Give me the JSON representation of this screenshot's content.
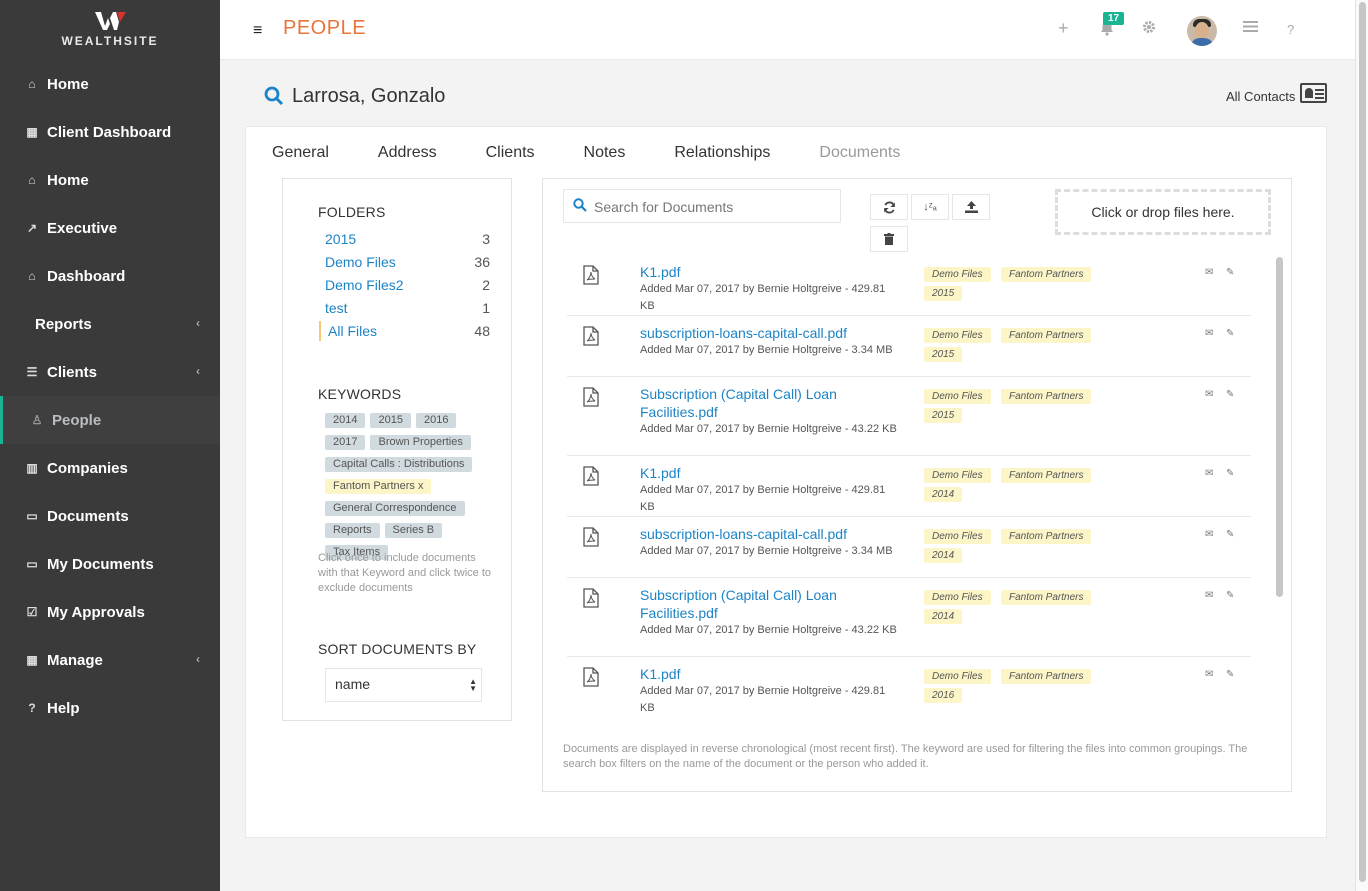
{
  "brand": {
    "name": "WEALTHSITE"
  },
  "sidebar": {
    "items": [
      {
        "label": "Home",
        "icon": "home-icon"
      },
      {
        "label": "Client Dashboard",
        "icon": "grid-icon"
      },
      {
        "label": "Home",
        "icon": "home-icon"
      },
      {
        "label": "Executive",
        "icon": "line-chart-icon"
      },
      {
        "label": "Dashboard",
        "icon": "home-icon"
      },
      {
        "label": "Reports",
        "icon": ""
      },
      {
        "label": "Clients",
        "icon": "list-icon"
      },
      {
        "label": "People",
        "icon": "user-icon"
      },
      {
        "label": "Companies",
        "icon": "building-icon"
      },
      {
        "label": "Documents",
        "icon": "folder-icon"
      },
      {
        "label": "My Documents",
        "icon": "folder-icon"
      },
      {
        "label": "My Approvals",
        "icon": "check-square-icon"
      },
      {
        "label": "Manage",
        "icon": "table-icon"
      },
      {
        "label": "Help",
        "icon": "question-icon"
      }
    ],
    "chevron": "‹",
    "accent": "#1ab394"
  },
  "topbar": {
    "page_title": "PEOPLE",
    "title_color": "#e8743b",
    "notification_count": "17",
    "menu_glyph": "≡",
    "plus_glyph": "+",
    "help_glyph": "?"
  },
  "person": {
    "name": "Larrosa, Gonzalo",
    "all_contacts": "All Contacts"
  },
  "tabs": [
    "General",
    "Address",
    "Clients",
    "Notes",
    "Relationships",
    "Documents"
  ],
  "folders": {
    "heading": "FOLDERS",
    "items": [
      {
        "name": "2015",
        "count": "3"
      },
      {
        "name": "Demo Files",
        "count": "36"
      },
      {
        "name": "Demo Files2",
        "count": "2"
      },
      {
        "name": "test",
        "count": "1"
      },
      {
        "name": "All Files",
        "count": "48"
      }
    ]
  },
  "keywords": {
    "heading": "KEYWORDS",
    "items": [
      "2014",
      "2015",
      "2016",
      "2017",
      "Brown Properties",
      "Capital Calls : Distributions",
      "Fantom Partners x",
      "General Correspondence",
      "Reports",
      "Series B",
      "Tax Items"
    ],
    "help": "Click once to include documents with that Keyword and click twice to exclude documents"
  },
  "sort": {
    "heading": "SORT DOCUMENTS BY",
    "selected": "name"
  },
  "documents": {
    "search_placeholder": "Search for Documents",
    "dropzone": "Click or drop files here.",
    "items": [
      {
        "name": "K1.pdf",
        "meta": "Added Mar 07, 2017 by Bernie Holtgreive - 429.81 KB",
        "tags": [
          "Demo Files",
          "Fantom Partners",
          "2015"
        ]
      },
      {
        "name": "subscription-loans-capital-call.pdf",
        "meta": "Added Mar 07, 2017 by Bernie Holtgreive - 3.34 MB",
        "tags": [
          "Demo Files",
          "Fantom Partners",
          "2015"
        ]
      },
      {
        "name": "Subscription (Capital Call) Loan Facilities.pdf",
        "meta": "Added Mar 07, 2017 by Bernie Holtgreive - 43.22 KB",
        "tags": [
          "Demo Files",
          "Fantom Partners",
          "2015"
        ]
      },
      {
        "name": "K1.pdf",
        "meta": "Added Mar 07, 2017 by Bernie Holtgreive - 429.81 KB",
        "tags": [
          "Demo Files",
          "Fantom Partners",
          "2014"
        ]
      },
      {
        "name": "subscription-loans-capital-call.pdf",
        "meta": "Added Mar 07, 2017 by Bernie Holtgreive - 3.34 MB",
        "tags": [
          "Demo Files",
          "Fantom Partners",
          "2014"
        ]
      },
      {
        "name": "Subscription (Capital Call) Loan Facilities.pdf",
        "meta": "Added Mar 07, 2017 by Bernie Holtgreive - 43.22 KB",
        "tags": [
          "Demo Files",
          "Fantom Partners",
          "2014"
        ]
      },
      {
        "name": "K1.pdf",
        "meta": "Added Mar 07, 2017 by Bernie Holtgreive - 429.81 KB",
        "tags": [
          "Demo Files",
          "Fantom Partners",
          "2016"
        ]
      }
    ],
    "footnote": "Documents are displayed in reverse chronological (most recent first). The keyword are used for filtering the files into common groupings. The search box filters on the name of the document or the person who added it."
  }
}
